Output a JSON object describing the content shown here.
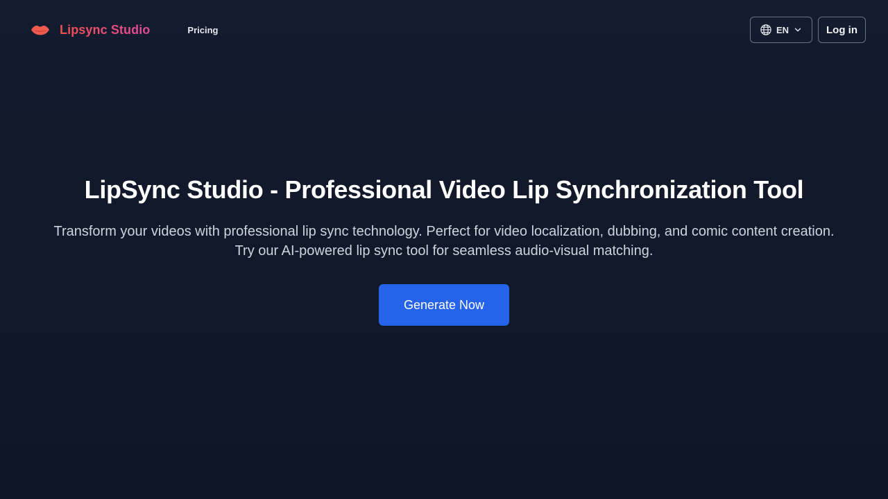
{
  "header": {
    "brand_name": "Lipsync Studio",
    "brand_icon": "lips-icon",
    "nav": [
      {
        "label": "Pricing"
      }
    ],
    "language": {
      "icon": "globe-icon",
      "selected": "EN",
      "chevron": "chevron-down-icon"
    },
    "login_label": "Log in"
  },
  "hero": {
    "title": "LipSync Studio - Professional Video Lip Synchronization Tool",
    "subtitle_line1": "Transform your videos with professional lip sync technology. Perfect for video localization, dubbing, and comic content creation.",
    "subtitle_line2": "Try our AI-powered lip sync tool for seamless audio-visual matching.",
    "cta_label": "Generate Now"
  },
  "colors": {
    "background": "#111827",
    "brand_gradient_start": "#f0504c",
    "brand_gradient_end": "#e04c9a",
    "cta": "#2563eb",
    "lips": "#f05a4f"
  }
}
